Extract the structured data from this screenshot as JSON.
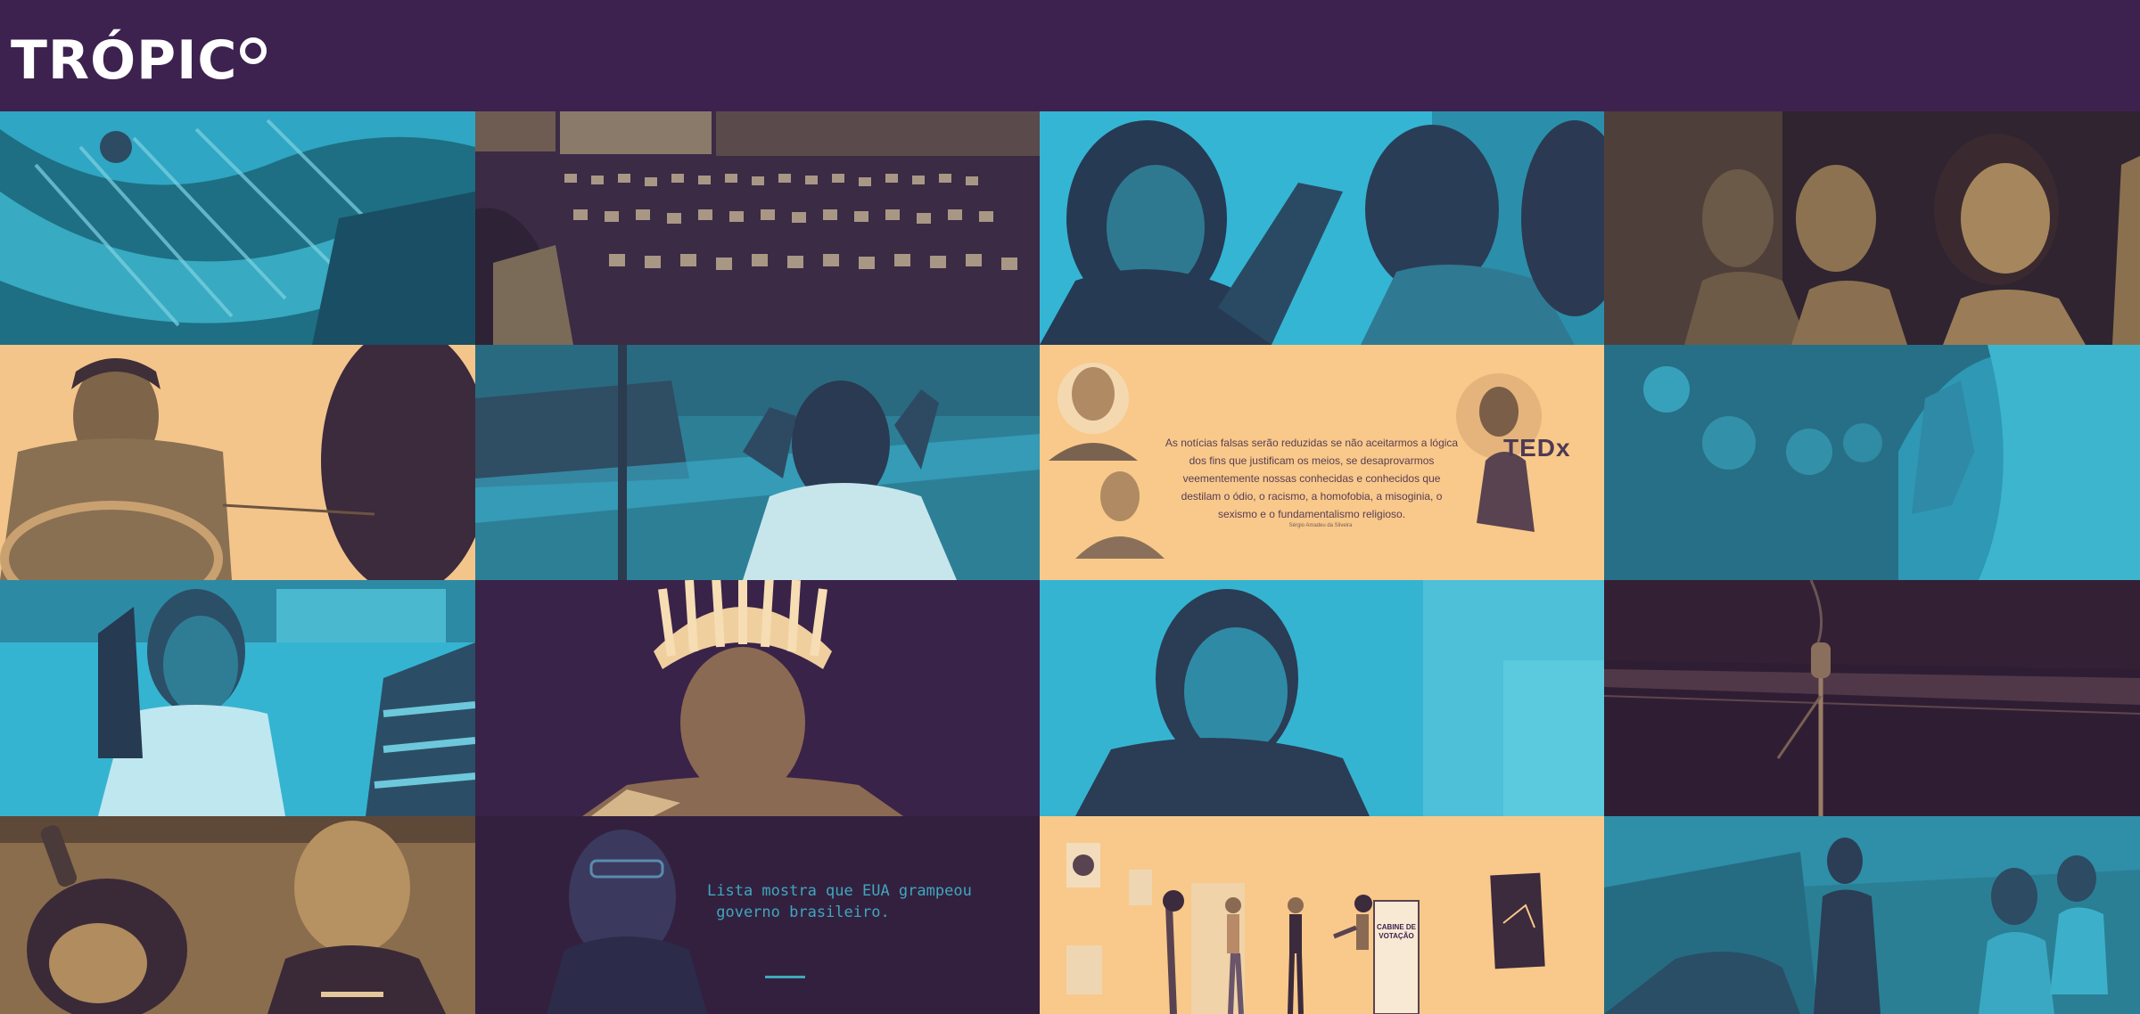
{
  "header": {
    "logo_text": "TRÓPIC",
    "background": "#3d2250"
  },
  "palette": {
    "cyan": "#2fb8d6",
    "teal": "#2a7f95",
    "sand": "#f8c98a",
    "tan": "#8d7048",
    "purple": "#3c2350"
  },
  "tiles": {
    "quote": {
      "text": "As notícias falsas serão reduzidas se não aceitarmos a lógica dos fins que justificam os meios, se desaprovarmos veementemente nossas conhecidas e conhecidos que destilam o ódio, o racismo, a homofobia, a misoginia, o sexismo e o fundamentalismo religioso.",
      "author": "Sérgio Amadeu da Silveira",
      "ted": "TEDx"
    },
    "headline": {
      "line1": "Lista mostra que EUA grampeou",
      "line2": " governo brasileiro."
    },
    "booth": {
      "line1": "CABINE DE",
      "line2": "VOTAÇÃO"
    }
  }
}
